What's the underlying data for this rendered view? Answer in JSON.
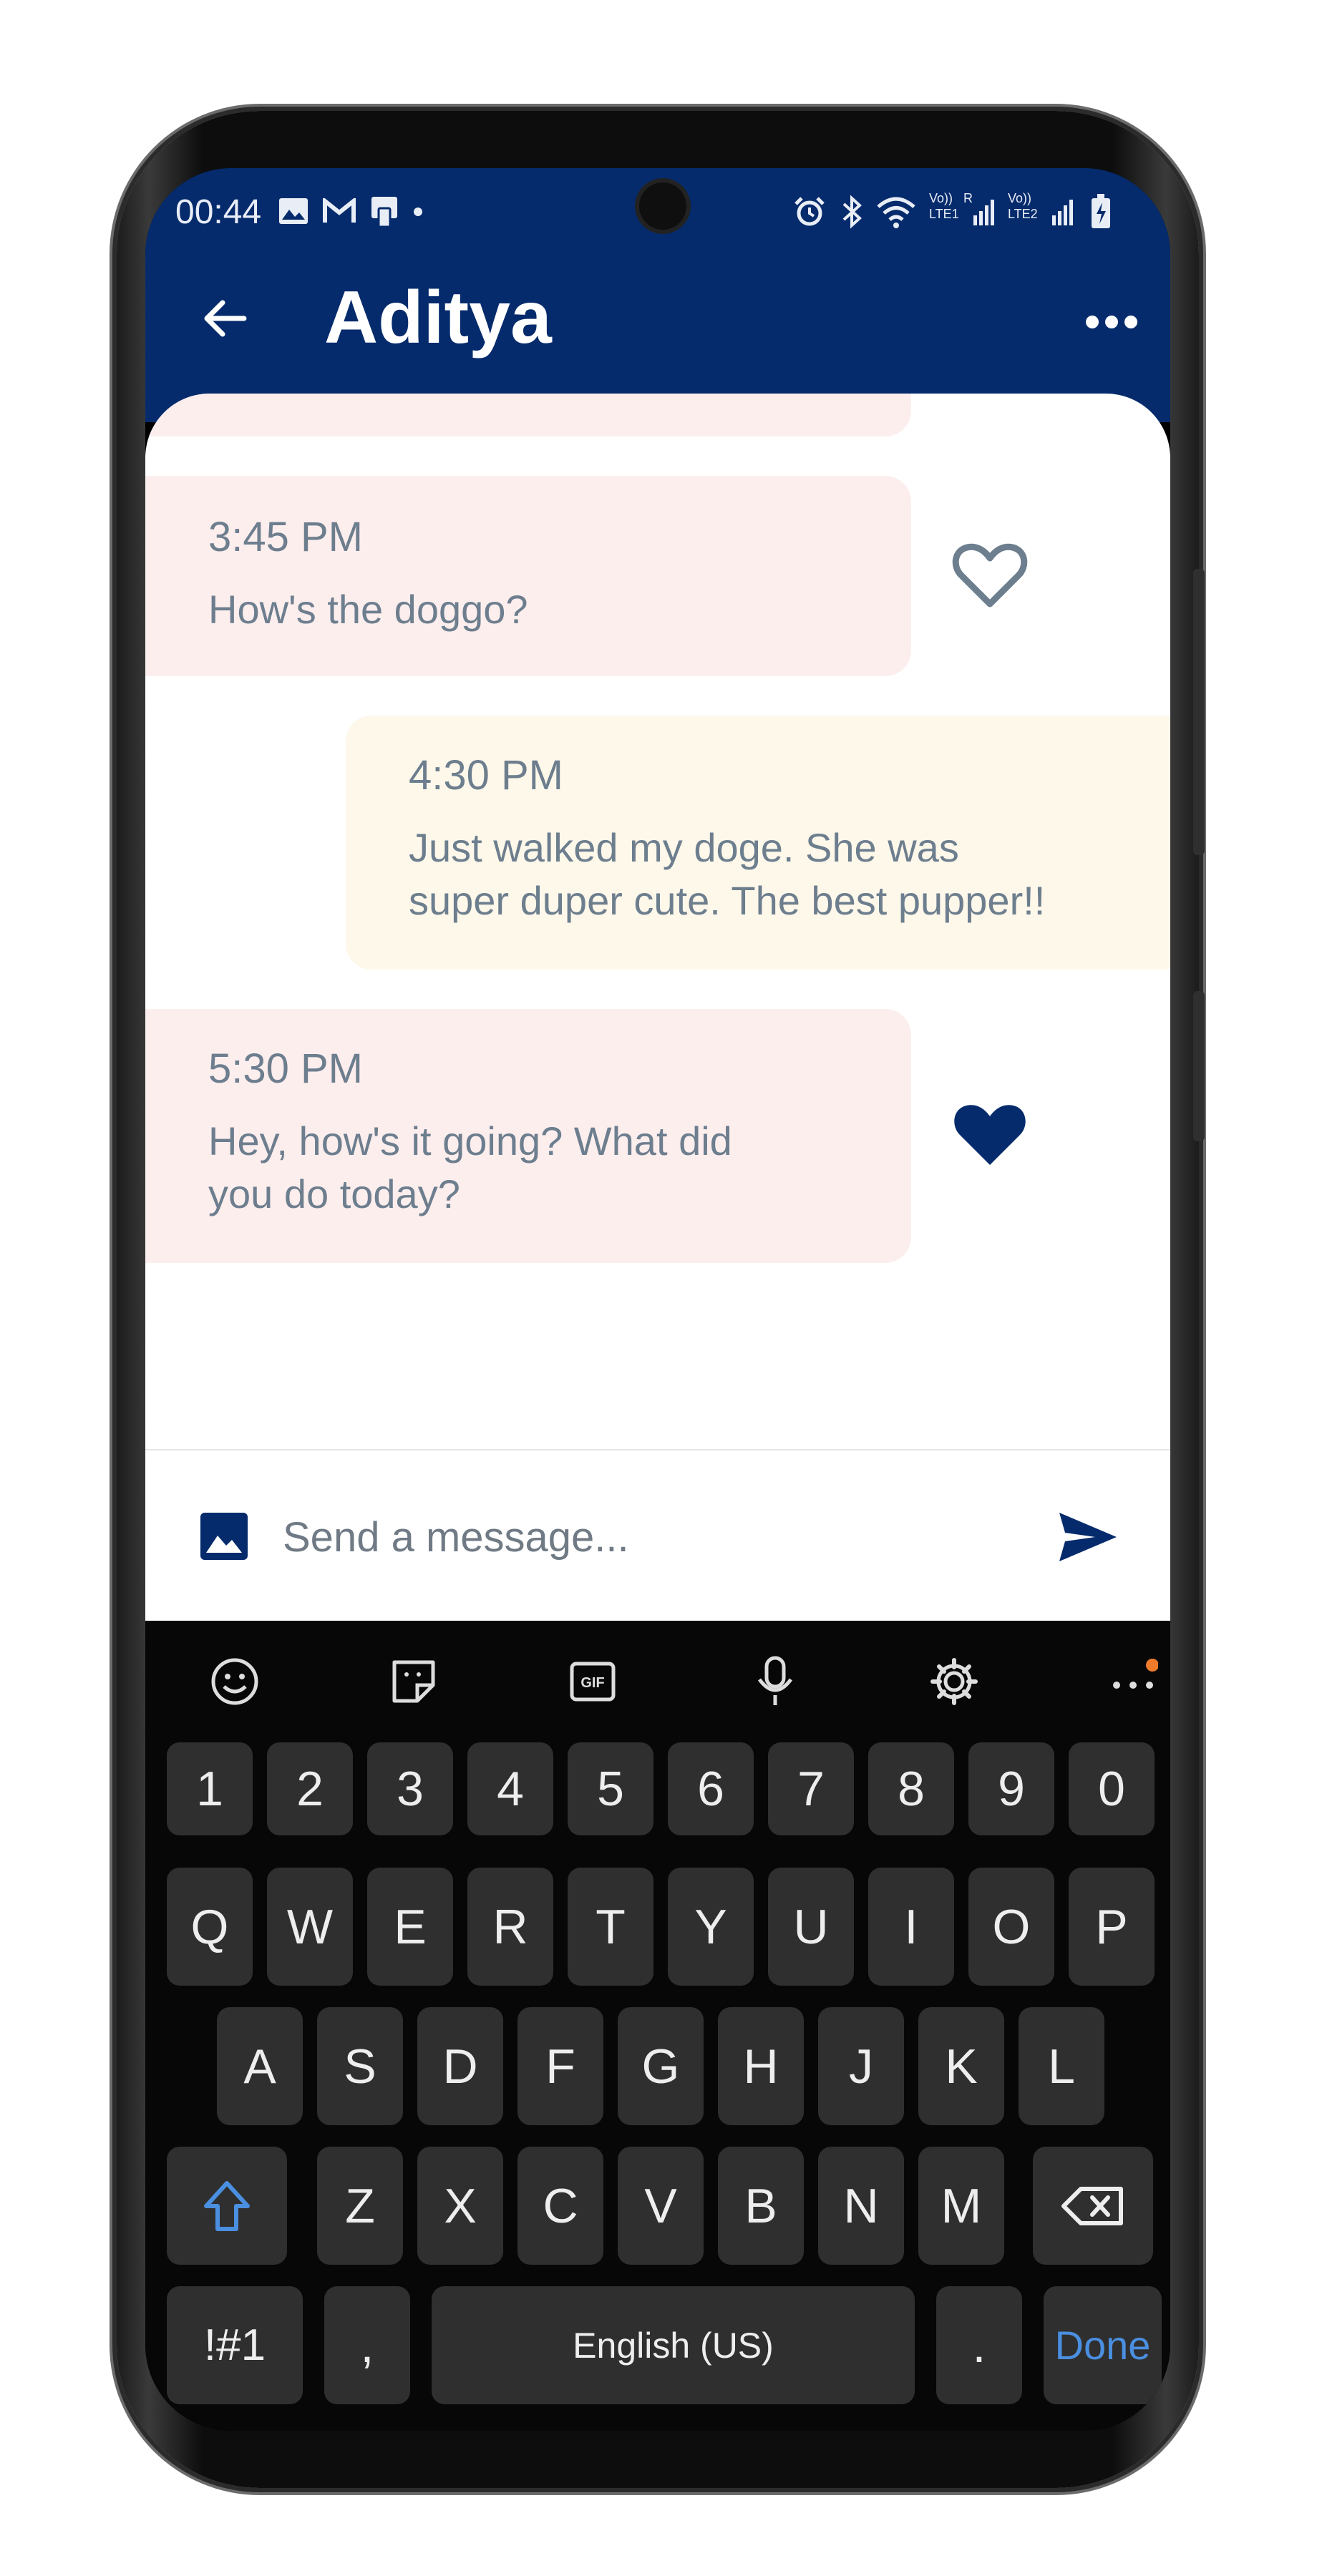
{
  "status_bar": {
    "time": "00:44"
  },
  "header": {
    "title": "Aditya"
  },
  "composer": {
    "placeholder": "Send a message..."
  },
  "messages": [
    {
      "time": "3:45 PM",
      "text": "How's the doggo?",
      "liked": false
    },
    {
      "time": "4:30 PM",
      "text_lines": [
        "Just walked my doge. She was",
        "super duper cute. The best pupper!!"
      ]
    },
    {
      "time": "5:30 PM",
      "text_lines": [
        "Hey, how's it going? What did",
        "you do today?"
      ],
      "liked": true
    }
  ],
  "keyboard": {
    "row_numbers": [
      "1",
      "2",
      "3",
      "4",
      "5",
      "6",
      "7",
      "8",
      "9",
      "0"
    ],
    "row_q": [
      "Q",
      "W",
      "E",
      "R",
      "T",
      "Y",
      "U",
      "I",
      "O",
      "P"
    ],
    "row_a": [
      "A",
      "S",
      "D",
      "F",
      "G",
      "H",
      "J",
      "K",
      "L"
    ],
    "row_z": [
      "Z",
      "X",
      "C",
      "V",
      "B",
      "N",
      "M"
    ],
    "symbols_key": "!#1",
    "comma_key": ",",
    "space_key": "English (US)",
    "period_key": ".",
    "done_key": "Done"
  },
  "colors": {
    "brand": "#052b6c",
    "incoming_bubble": "#fdeeee",
    "outgoing_bubble": "#fef8ea",
    "done": "#4a8fe0"
  }
}
